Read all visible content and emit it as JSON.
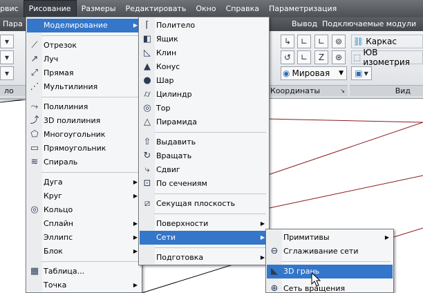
{
  "menubar": {
    "items": [
      "рвис",
      "Рисование",
      "Размеры",
      "Редактировать",
      "Окно",
      "Справка",
      "Параметризация"
    ],
    "active_index": 1
  },
  "ribbon_tabs": {
    "left": "Пара",
    "vyvod": "Вывод",
    "modules": "Подключаемые модули"
  },
  "ribbon": {
    "karkas": "Каркас",
    "izometria": "ЮВ изометрия",
    "mirovaya": "Мировая",
    "koordinaty": "Координаты",
    "vid": "Вид",
    "panel_left": "ло"
  },
  "draw_menu": {
    "items": [
      {
        "label": "Моделирование",
        "icon": "none",
        "submenu": true,
        "highlighted": true
      },
      {
        "label": "Отрезок",
        "icon": "line-icon"
      },
      {
        "label": "Луч",
        "icon": "ray-icon"
      },
      {
        "label": "Прямая",
        "icon": "xline-icon"
      },
      {
        "label": "Мультилиния",
        "icon": "mline-icon"
      },
      {
        "label": "Полилиния",
        "icon": "polyline-icon"
      },
      {
        "label": "3D полилиния",
        "icon": "3d-polyline-icon"
      },
      {
        "label": "Многоугольник",
        "icon": "polygon-icon"
      },
      {
        "label": "Прямоугольник",
        "icon": "rectangle-icon"
      },
      {
        "label": "Спираль",
        "icon": "helix-icon"
      },
      {
        "label": "Дуга",
        "icon": "none",
        "submenu": true
      },
      {
        "label": "Круг",
        "icon": "none",
        "submenu": true
      },
      {
        "label": "Кольцо",
        "icon": "donut-icon"
      },
      {
        "label": "Сплайн",
        "icon": "none",
        "submenu": true
      },
      {
        "label": "Эллипс",
        "icon": "none",
        "submenu": true
      },
      {
        "label": "Блок",
        "icon": "none",
        "submenu": true
      },
      {
        "label": "Таблица...",
        "icon": "table-icon"
      },
      {
        "label": "Точка",
        "icon": "none",
        "submenu": true
      }
    ]
  },
  "model_menu": {
    "items": [
      {
        "label": "Политело",
        "icon": "polysolid-icon"
      },
      {
        "label": "Ящик",
        "icon": "box-icon"
      },
      {
        "label": "Клин",
        "icon": "wedge-icon"
      },
      {
        "label": "Конус",
        "icon": "cone-icon"
      },
      {
        "label": "Шар",
        "icon": "sphere-icon"
      },
      {
        "label": "Цилиндр",
        "icon": "cylinder-icon"
      },
      {
        "label": "Тор",
        "icon": "torus-icon"
      },
      {
        "label": "Пирамида",
        "icon": "pyramid-icon"
      },
      {
        "label": "Выдавить",
        "icon": "extrude-icon"
      },
      {
        "label": "Вращать",
        "icon": "revolve-icon"
      },
      {
        "label": "Сдвиг",
        "icon": "sweep-icon"
      },
      {
        "label": "По сечениям",
        "icon": "loft-icon"
      },
      {
        "label": "Секущая плоскость",
        "icon": "section-plane-icon"
      },
      {
        "label": "Поверхности",
        "icon": "none",
        "submenu": true
      },
      {
        "label": "Сети",
        "icon": "none",
        "submenu": true,
        "highlighted": true
      },
      {
        "label": "Подготовка",
        "icon": "none",
        "submenu": true
      }
    ]
  },
  "mesh_menu": {
    "items": [
      {
        "label": "Примитивы",
        "icon": "none",
        "submenu": true
      },
      {
        "label": "Сглаживание сети",
        "icon": "smooth-mesh-icon"
      },
      {
        "label": "3D грань",
        "icon": "3d-face-icon",
        "highlighted": true
      },
      {
        "label": "Сеть вращения",
        "icon": "revolved-mesh-icon"
      }
    ]
  }
}
